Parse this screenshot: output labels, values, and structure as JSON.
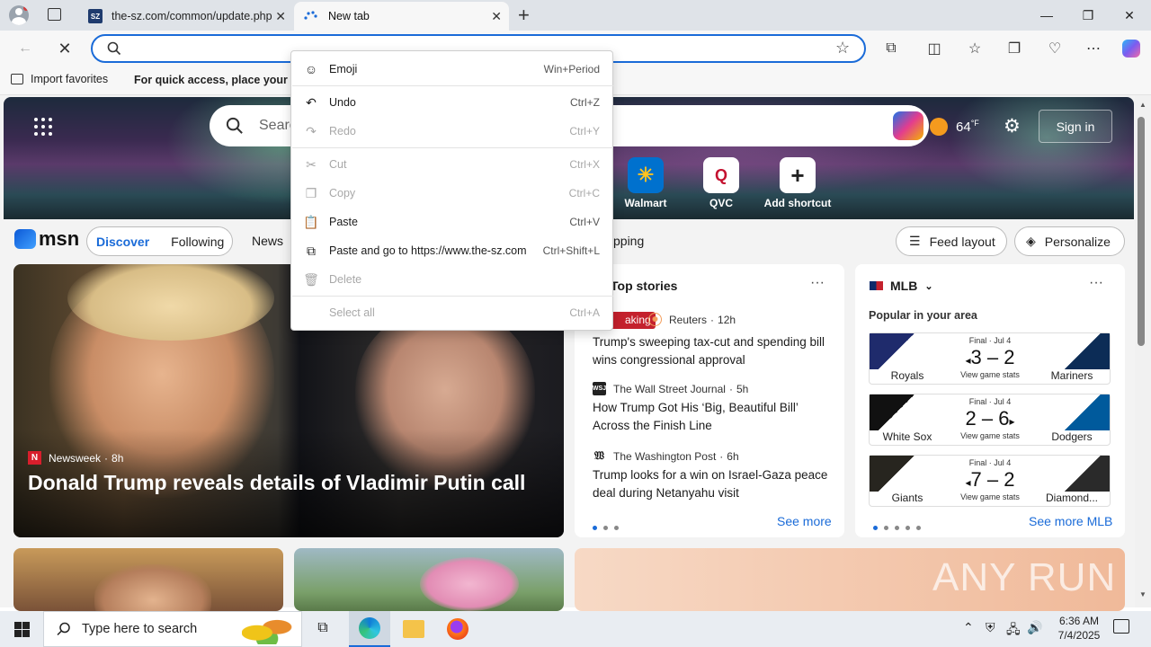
{
  "tabs": [
    {
      "title": "the-sz.com/common/update.php",
      "favicon": "SZ"
    },
    {
      "title": "New tab"
    }
  ],
  "favorites_bar": {
    "import_label": "Import favorites",
    "hint": "For quick access, place your favo"
  },
  "msn": {
    "logo": "msn",
    "search_placeholder": "Search",
    "weather_temp": "64",
    "weather_unit": "°F",
    "sign_in": "Sign in",
    "shortcuts": [
      {
        "label": "Walmart"
      },
      {
        "label": "QVC"
      },
      {
        "label": "Add shortcut"
      }
    ],
    "nav_tabs": [
      "Discover",
      "Following",
      "News"
    ],
    "nav_tail": "pping",
    "feed_layout": "Feed layout",
    "personalize": "Personalize"
  },
  "feature": {
    "source": "Newsweek",
    "age": "8h",
    "headline": "Donald Trump reveals details of Vladimir Putin call"
  },
  "top_stories": {
    "title": "Top stories",
    "badge": "aking",
    "see_more": "See more",
    "items": [
      {
        "source": "Reuters",
        "age": "12h",
        "headline": "Trump's sweeping tax-cut and spending bill wins congressional approval"
      },
      {
        "source": "The Wall Street Journal",
        "age": "5h",
        "headline": "How Trump Got His ‘Big, Beautiful Bill’ Across the Finish Line"
      },
      {
        "source": "The Washington Post",
        "age": "6h",
        "headline": "Trump looks for a win on Israel-Gaza peace deal during Netanyahu visit"
      }
    ]
  },
  "mlb": {
    "title": "MLB",
    "subtitle": "Popular in your area",
    "see_more": "See more MLB",
    "games": [
      {
        "status": "Final · Jul 4",
        "home": "Royals",
        "away": "Mariners",
        "home_score": "3",
        "away_score": "2",
        "winner": "home",
        "stats": "View game stats"
      },
      {
        "status": "Final · Jul 4",
        "home": "White Sox",
        "away": "Dodgers",
        "home_score": "2",
        "away_score": "6",
        "winner": "away",
        "stats": "View game stats"
      },
      {
        "status": "Final · Jul 4",
        "home": "Giants",
        "away": "Diamond...",
        "home_score": "7",
        "away_score": "2",
        "winner": "home",
        "stats": "View game stats"
      }
    ]
  },
  "context_menu": [
    {
      "label": "Emoji",
      "shortcut": "Win+Period",
      "enabled": true,
      "icon": "emoji-icon"
    },
    {
      "label": "Undo",
      "shortcut": "Ctrl+Z",
      "enabled": true,
      "icon": "undo-icon"
    },
    {
      "label": "Redo",
      "shortcut": "Ctrl+Y",
      "enabled": false,
      "icon": "redo-icon"
    },
    {
      "label": "Cut",
      "shortcut": "Ctrl+X",
      "enabled": false,
      "icon": "cut-icon"
    },
    {
      "label": "Copy",
      "shortcut": "Ctrl+C",
      "enabled": false,
      "icon": "copy-icon"
    },
    {
      "label": "Paste",
      "shortcut": "Ctrl+V",
      "enabled": true,
      "icon": "paste-icon"
    },
    {
      "label": "Paste and go to https://www.the-sz.com",
      "shortcut": "Ctrl+Shift+L",
      "enabled": true,
      "icon": "paste-go-icon"
    },
    {
      "label": "Delete",
      "shortcut": "",
      "enabled": false,
      "icon": "delete-icon"
    },
    {
      "label": "Select all",
      "shortcut": "Ctrl+A",
      "enabled": false,
      "icon": ""
    }
  ],
  "watermark": "ANY RUN",
  "taskbar": {
    "search_placeholder": "Type here to search",
    "time": "6:36 AM",
    "date": "7/4/2025"
  }
}
